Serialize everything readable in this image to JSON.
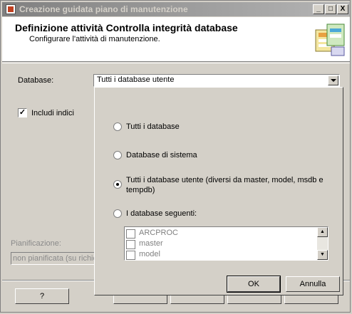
{
  "window": {
    "title": "Creazione guidata piano di manutenzione",
    "controls": [
      "_",
      "□",
      "X"
    ]
  },
  "header": {
    "title": "Definizione attività Controlla integrità database",
    "subtitle": "Configurare l'attività di manutenzione."
  },
  "form": {
    "database_label": "Database:",
    "database_value": "Tutti i database utente",
    "include_indexes_label": "Includi indici",
    "include_indexes_checked": true,
    "schedule_label": "Pianificazione:",
    "schedule_value": "non pianificata (su richie"
  },
  "popup": {
    "options": [
      {
        "label": "Tutti i database",
        "selected": false
      },
      {
        "label": "Database di sistema",
        "selected": false
      },
      {
        "label_line1": "Tutti i database utente (diversi da master, model, msdb e",
        "label_line2": "tempdb)",
        "selected": true
      },
      {
        "label": "I database seguenti:",
        "selected": false
      }
    ],
    "database_list": [
      "ARCPROC",
      "master",
      "model"
    ],
    "ok_label": "OK",
    "cancel_label": "Annulla"
  },
  "footer": {
    "help_label": "?"
  }
}
